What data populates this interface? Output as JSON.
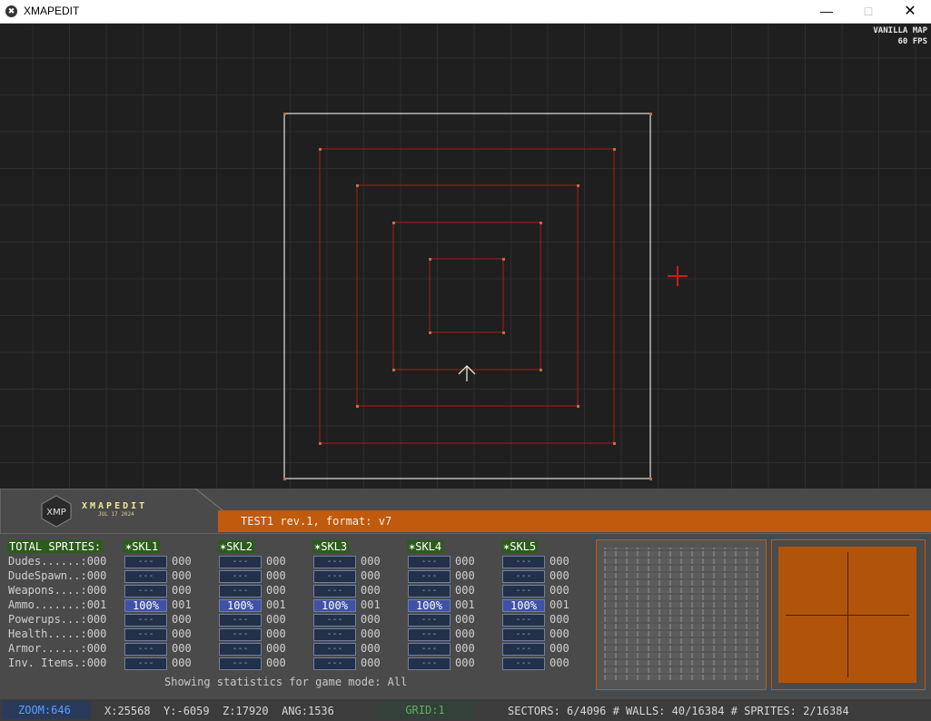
{
  "window": {
    "title": "XMAPEDIT",
    "icon": "xmapedit-app-icon",
    "min": "—",
    "max": "□",
    "close": "✕"
  },
  "viewport": {
    "map_type": "VANILLA MAP",
    "fps": "60 FPS"
  },
  "logo": {
    "brand": "XMAPEDIT",
    "date": "JUL 17 2024",
    "mark": "XMP"
  },
  "map_name": "TEST1 rev.1, format: v7",
  "stats": {
    "header": "TOTAL SPRITES:",
    "rows": [
      "Dudes......:000",
      "DudeSpawn..:000",
      "Weapons....:000",
      "Ammo.......:001",
      "Powerups...:000",
      "Health.....:000",
      "Armor......:000",
      "Inv. Items.:000"
    ],
    "skills": [
      {
        "name": "✶SKL1",
        "cells": [
          "---",
          "---",
          "---",
          "100%",
          "---",
          "---",
          "---",
          "---"
        ],
        "values": [
          "000",
          "000",
          "000",
          "001",
          "000",
          "000",
          "000",
          "000"
        ]
      },
      {
        "name": "✶SKL2",
        "cells": [
          "---",
          "---",
          "---",
          "100%",
          "---",
          "---",
          "---",
          "---"
        ],
        "values": [
          "000",
          "000",
          "000",
          "001",
          "000",
          "000",
          "000",
          "000"
        ]
      },
      {
        "name": "✶SKL3",
        "cells": [
          "---",
          "---",
          "---",
          "100%",
          "---",
          "---",
          "---",
          "---"
        ],
        "values": [
          "000",
          "000",
          "000",
          "001",
          "000",
          "000",
          "000",
          "000"
        ]
      },
      {
        "name": "✶SKL4",
        "cells": [
          "---",
          "---",
          "---",
          "100%",
          "---",
          "---",
          "---",
          "---"
        ],
        "values": [
          "000",
          "000",
          "000",
          "001",
          "000",
          "000",
          "000",
          "000"
        ]
      },
      {
        "name": "✶SKL5",
        "cells": [
          "---",
          "---",
          "---",
          "100%",
          "---",
          "---",
          "---",
          "---"
        ],
        "values": [
          "000",
          "000",
          "000",
          "001",
          "000",
          "000",
          "000",
          "000"
        ]
      }
    ],
    "game_mode": "Showing statistics for game mode: All"
  },
  "status": {
    "zoom": "ZOOM:646",
    "coords": "X:25568  Y:-6059  Z:17920  ANG:1536",
    "grid": "GRID:1",
    "counts": "SECTORS: 6/4096 # WALLS: 40/16384 # SPRITES: 2/16384"
  },
  "colors": {
    "accent": "#c05a0c",
    "wall_red": "#b01818",
    "outer_wall": "#e0e0e0",
    "status_zoom": "#5aa0ff",
    "status_grid": "#5fb05f"
  }
}
